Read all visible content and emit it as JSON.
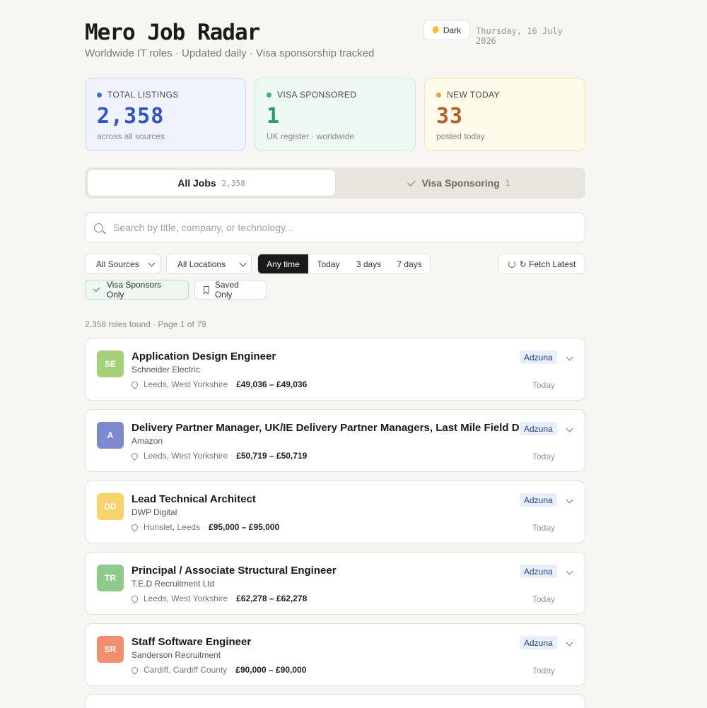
{
  "header": {
    "title": "Mero Job Radar",
    "subtitle": "Worldwide IT roles · Updated daily · Visa sponsorship tracked",
    "theme_toggle": "Dark",
    "date": "Thursday, 16 July 2026"
  },
  "stats": [
    {
      "label": "TOTAL LISTINGS",
      "value": "2,358",
      "sub": "across all sources",
      "color": "#2f55c8"
    },
    {
      "label": "VISA SPONSORED",
      "value": "1",
      "sub": "UK register · worldwide",
      "color": "#2a9d6a"
    },
    {
      "label": "NEW TODAY",
      "value": "33",
      "sub": "posted today",
      "color": "#b3622a"
    }
  ],
  "tabs": [
    {
      "label": "All Jobs",
      "count": "2,358",
      "active": true
    },
    {
      "label": "Visa Sponsoring",
      "count": "1",
      "active": false
    }
  ],
  "search": {
    "placeholder": "Search by title, company, or technology..."
  },
  "filters": {
    "source": "All Sources",
    "location": "All Locations",
    "time_options": [
      "Any time",
      "Today",
      "3 days",
      "7 days"
    ],
    "time_selected": "Any time",
    "fetch_label": "↻ Fetch Latest",
    "visa_chip": "Visa Sponsors Only",
    "saved_chip": "Saved Only"
  },
  "results": {
    "summary": "2,358 roles found · Page 1 of 79"
  },
  "jobs": [
    {
      "initials": "SE",
      "avatar_color": "#a5d07a",
      "title": "Application Design Engineer",
      "company": "Schneider Electric",
      "location": "Leeds, West Yorkshire",
      "salary": "£49,036 – £49,036",
      "source": "Adzuna",
      "posted": "Today"
    },
    {
      "initials": "A",
      "avatar_color": "#7e88cf",
      "title": "Delivery Partner Manager, UK/IE Delivery Partner Managers, Last Mile Field DSP",
      "company": "Amazon",
      "location": "Leeds, West Yorkshire",
      "salary": "£50,719 – £50,719",
      "source": "Adzuna",
      "posted": "Today"
    },
    {
      "initials": "DD",
      "avatar_color": "#f7d46b",
      "title": "Lead Technical Architect",
      "company": "DWP Digital",
      "location": "Hunslet, Leeds",
      "salary": "£95,000 – £95,000",
      "source": "Adzuna",
      "posted": "Today"
    },
    {
      "initials": "TR",
      "avatar_color": "#8ecb8a",
      "title": "Principal / Associate Structural Engineer",
      "company": "T.E.D Recruitment Ltd",
      "location": "Leeds, West Yorkshire",
      "salary": "£62,278 – £62,278",
      "source": "Adzuna",
      "posted": "Today"
    },
    {
      "initials": "SR",
      "avatar_color": "#ef8f6f",
      "title": "Staff Software Engineer",
      "company": "Sanderson Recruitment",
      "location": "Cardiff, Cardiff County",
      "salary": "£90,000 – £90,000",
      "source": "Adzuna",
      "posted": "Today"
    }
  ]
}
